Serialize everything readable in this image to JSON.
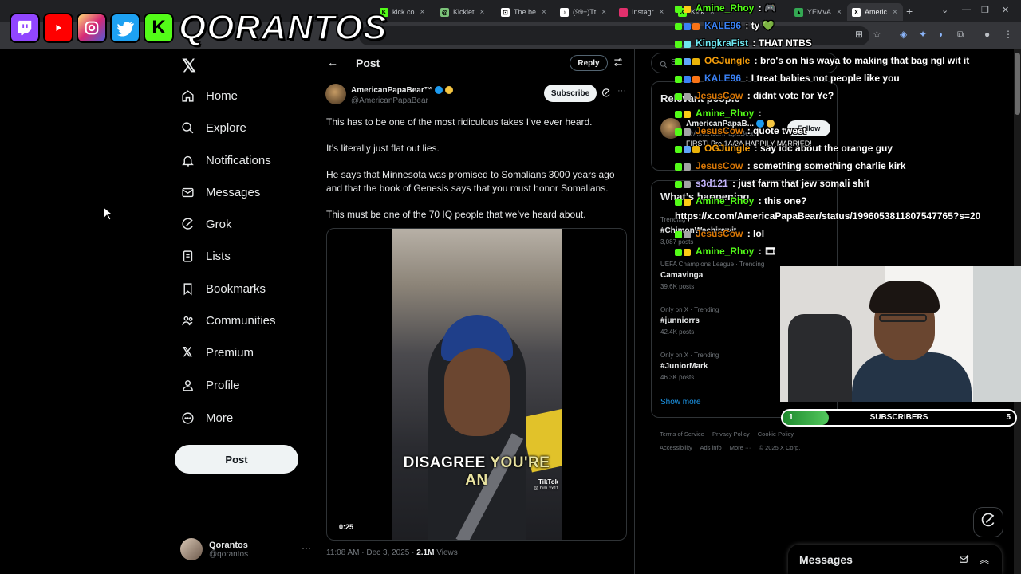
{
  "browser": {
    "tabs": [
      {
        "label": "kick.co",
        "fav_color": "#53fc18"
      },
      {
        "label": "Kicklet",
        "fav_color": "#7cc47a"
      },
      {
        "label": "The be",
        "fav_color": "#ffffff"
      },
      {
        "label": "(99+)Tt",
        "fav_color": "#ffffff"
      },
      {
        "label": "Instagr",
        "fav_color": "#e1306c"
      },
      {
        "label": "Kick",
        "fav_color": "#53fc18"
      },
      {
        "label": "YEMvA",
        "fav_color": "#34a853"
      },
      {
        "label": "Americ",
        "fav_color": "#ffffff"
      }
    ]
  },
  "overlay": {
    "brand": "QORANTOS",
    "sub_goal": {
      "label": "SUBSCRIBERS",
      "start": "1",
      "goal": "5",
      "progress": 0.2
    }
  },
  "nav": {
    "items": [
      {
        "label": "Home",
        "icon": "home-icon"
      },
      {
        "label": "Explore",
        "icon": "search-icon"
      },
      {
        "label": "Notifications",
        "icon": "bell-icon"
      },
      {
        "label": "Messages",
        "icon": "envelope-icon"
      },
      {
        "label": "Grok",
        "icon": "grok-icon"
      },
      {
        "label": "Lists",
        "icon": "list-icon"
      },
      {
        "label": "Bookmarks",
        "icon": "bookmark-icon"
      },
      {
        "label": "Communities",
        "icon": "people-icon"
      },
      {
        "label": "Premium",
        "icon": "x-icon"
      },
      {
        "label": "Profile",
        "icon": "person-icon"
      },
      {
        "label": "More",
        "icon": "more-circle-icon"
      }
    ],
    "post_button": "Post",
    "account": {
      "name": "Qorantos",
      "handle": "@qorantos",
      "more": "···"
    }
  },
  "post": {
    "header_title": "Post",
    "reply_label": "Reply",
    "author": {
      "name": "AmericanPapaBear™",
      "handle": "@AmericanPapaBear"
    },
    "subscribe_label": "Subscribe",
    "more": "···",
    "paragraphs": [
      "This has to be one of the most ridiculous takes I’ve ever heard.",
      "It’s literally just flat out lies.",
      "He says that Minnesota was promised to Somalians 3000 years ago and that the book of Genesis says that you must honor Somalians.",
      "This must be one of the 70 IQ people that we’ve heard about."
    ],
    "video": {
      "caption_a": "DISAGREE ",
      "caption_b": "YOU'RE AN",
      "watermark": "TikTok",
      "watermark_handle": "@ him.xx11",
      "duration": "0:25"
    },
    "meta": {
      "time": "11:08 AM · Dec 3, 2025 · ",
      "views": "2.1M",
      "views_label": " Views"
    }
  },
  "right": {
    "search_placeholder": "S",
    "relevant_title": "Relevant people",
    "relevant": {
      "name": "AmericanPapaB...",
      "handle": "@AmericanPapaBear",
      "bio": "FIRST! Pro 1A/2A HAPPILY MARRIED!",
      "follow": "Follow"
    },
    "happening_title": "What’s happening",
    "trends": [
      {
        "context": "Trending",
        "name": "#ChimonWachirawit",
        "count": "3,087 posts"
      },
      {
        "context": "UEFA Champions League · Trending",
        "name": "Camavinga",
        "count": "39.6K posts"
      },
      {
        "context": "Only on X · Trending",
        "name": "#junniorrs",
        "count": "42.4K posts"
      },
      {
        "context": "Only on X · Trending",
        "name": "#JuniorMark",
        "count": "46.3K posts"
      }
    ],
    "show_more": "Show more",
    "footer": [
      "Terms of Service",
      "Privacy Policy",
      "Cookie Policy",
      "Accessibility",
      "Ads info",
      "More ···",
      "© 2025 X Corp."
    ]
  },
  "chat": [
    {
      "user": "Amine_Rhoy",
      "color": "#53fc18",
      "msg": "🎮"
    },
    {
      "user": "KALE96",
      "color": "#3b82f6",
      "msg": "ty 💚"
    },
    {
      "user": "KingkraFist",
      "color": "#6ee7f0",
      "msg": "THAT NTBS"
    },
    {
      "user": "OGJungle",
      "color": "#f59e0b",
      "msg": "bro's on his waya to making that bag ngl wit it"
    },
    {
      "user": "KALE96",
      "color": "#3b82f6",
      "msg": "I treat babies not people like you"
    },
    {
      "user": "JesusCow",
      "color": "#d97706",
      "msg": "didnt vote for Ye?"
    },
    {
      "user": "Amine_Rhoy",
      "color": "#53fc18",
      "msg": ""
    },
    {
      "user": "JesusCow",
      "color": "#d97706",
      "msg": "quote tweet"
    },
    {
      "user": "OGJungle",
      "color": "#f59e0b",
      "msg": "say idc about the orange guy"
    },
    {
      "user": "JesusCow",
      "color": "#d97706",
      "msg": "something something charlie kirk"
    },
    {
      "user": "s3d121",
      "color": "#c4b5fd",
      "msg": "just farm that jew somali shit"
    },
    {
      "user": "Amine_Rhoy",
      "color": "#53fc18",
      "msg": "this one?"
    },
    {
      "user": "",
      "color": "#ffffff",
      "msg": "https://x.com/AmericaPapaBear/status/1996053811807547765?s=20"
    },
    {
      "user": "JesusCow",
      "color": "#d97706",
      "msg": "lol"
    },
    {
      "user": "Amine_Rhoy",
      "color": "#53fc18",
      "msg": "🎞"
    }
  ],
  "messages_drawer": {
    "title": "Messages"
  },
  "colors": {
    "accent": "#1d9bf0",
    "kick_green": "#53fc18",
    "background": "#000000",
    "text": "#e7e9ea",
    "muted": "#71767b"
  }
}
